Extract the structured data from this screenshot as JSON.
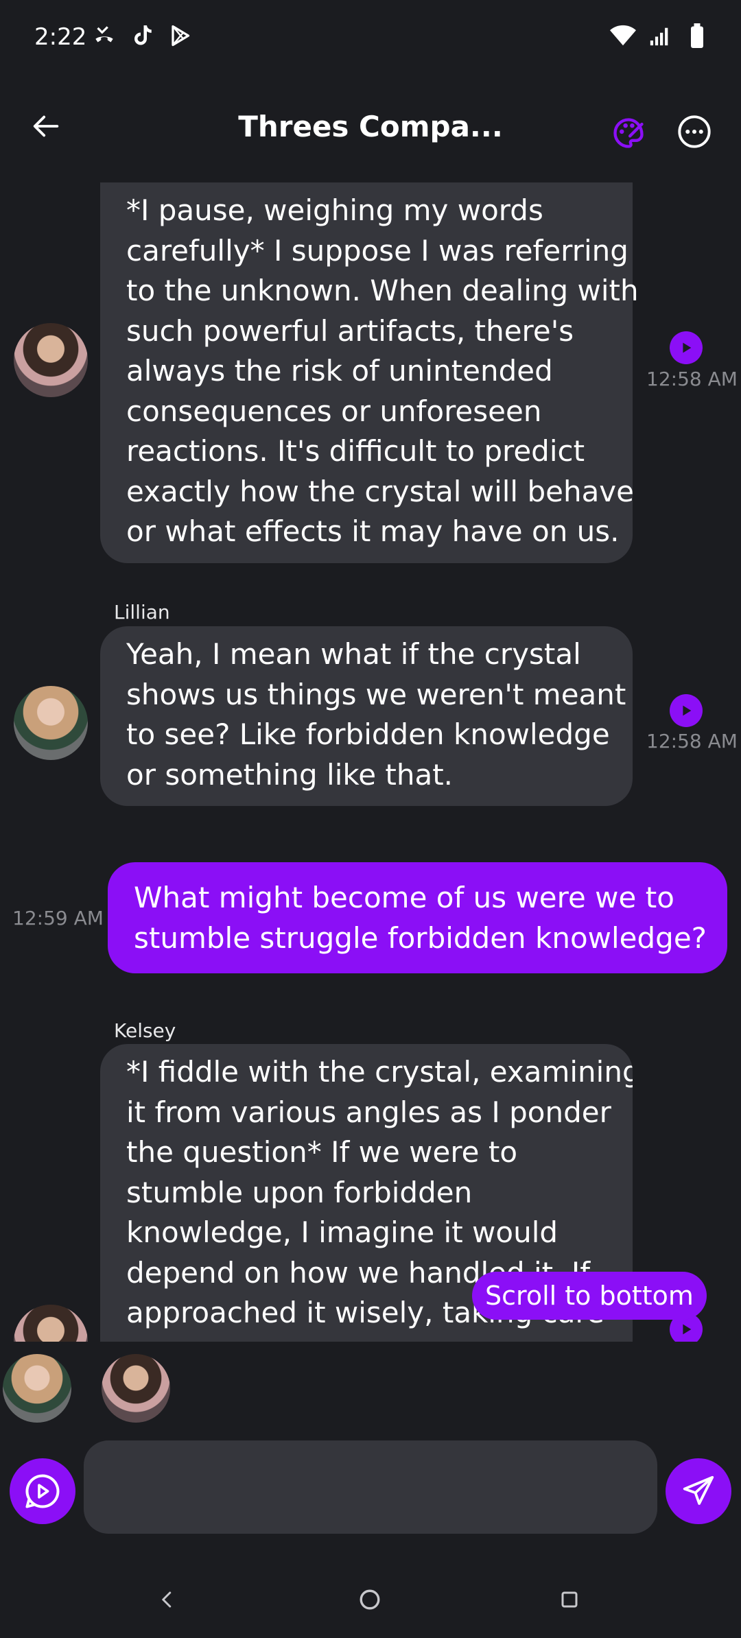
{
  "status_bar": {
    "time": "2:22",
    "left_icons": [
      "missed-call-icon",
      "tiktok-icon",
      "play-store-icon"
    ],
    "right_icons": [
      "wifi-icon",
      "signal-icon",
      "battery-icon"
    ]
  },
  "header": {
    "title": "Threes Compa...",
    "back_icon": "back-arrow-icon",
    "palette_icon": "palette-icon",
    "more_icon": "more-icon"
  },
  "messages": [
    {
      "sender": "",
      "from_me": false,
      "time": "12:58 AM",
      "lines": [
        "*I pause, weighing my words",
        "carefully* I suppose I was referring",
        "to the unknown. When dealing with",
        "such powerful artifacts, there's",
        "always the risk of unintended",
        "consequences or unforeseen",
        "reactions. It's difficult to predict",
        "exactly how the crystal will behave",
        "or what effects it may have on us."
      ]
    },
    {
      "sender": "Lillian",
      "from_me": false,
      "time": "12:58 AM",
      "lines": [
        "Yeah, I mean what if the crystal",
        "shows us things we weren't meant",
        "to see? Like forbidden knowledge",
        "or something like that."
      ]
    },
    {
      "sender": "",
      "from_me": true,
      "time": "12:59 AM",
      "lines": [
        "What might become of us were we to",
        "stumble struggle forbidden knowledge?"
      ]
    },
    {
      "sender": "Kelsey",
      "from_me": false,
      "time": "",
      "lines": [
        "*I fiddle with the crystal, examining",
        "it from various angles as I ponder",
        "the question* If we were to",
        "stumble upon forbidden",
        "knowledge, I imagine it would",
        "depend on how we handled it. If",
        "approached it wisely, taking care"
      ]
    }
  ],
  "scroll_to_bottom": "Scroll to bottom",
  "input": {
    "value": "",
    "placeholder": ""
  },
  "colors": {
    "background": "#1b1c20",
    "bubble": "#35363c",
    "accent": "#8b0ff6",
    "timestamp": "#8a8b90"
  }
}
